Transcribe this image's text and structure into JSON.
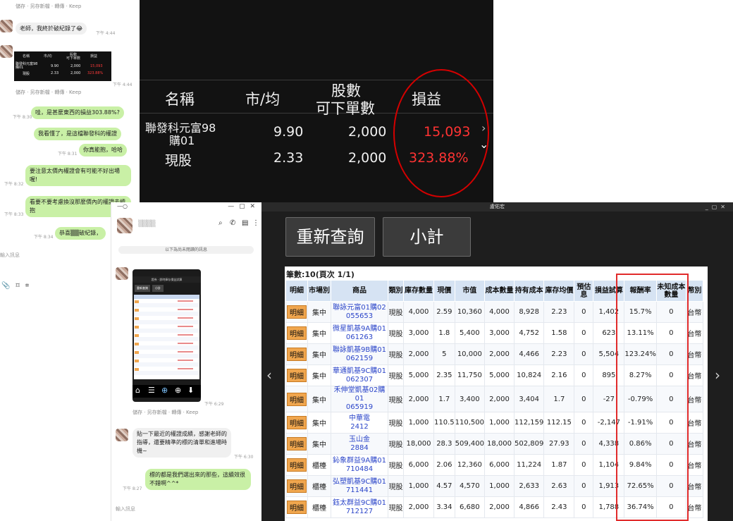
{
  "chat1": {
    "actions_1": "儲存 · 另存新檔 · 轉傳 · Keep",
    "msg_1": "老師，我終於破紀錄了😂",
    "time_1": "下午 4:44",
    "mini_table": {
      "headers": [
        "名稱",
        "市/均",
        "股數\n可下單數",
        "損益"
      ],
      "row1": [
        "聯發科元富98\n購01",
        "9.90",
        "2,000",
        "15,093"
      ],
      "row2": [
        "現股",
        "2.33",
        "2,000",
        "323.88%"
      ]
    },
    "time_2": "下午 4:44",
    "actions_2": "儲存 · 另存新檔 · 轉傳 · Keep",
    "out_1": "哇，是甚麼東西的損益303.88%?",
    "out_1_time": "下午 8:30",
    "out_2": "我看懂了，是這檔聯發科的權證",
    "out_3": "你真能抱，哈哈",
    "out_3_time": "下午 8:31",
    "out_4": "要注意太價內權證會有可能不好出場喔!",
    "out_4_time": "下午 8:32",
    "out_5": "看要不要考慮換沒那麼價內的權證去續抱",
    "out_5_time": "下午 8:33",
    "out_6": "恭喜▒▒破紀錄，",
    "out_6_time": "下午 8:34",
    "input_placeholder": "輸入訊息"
  },
  "zoom": {
    "headers": [
      "名稱",
      "市/均",
      "股數",
      "可下單數",
      "損益"
    ],
    "row1": {
      "name_line1": "聯發科元富98",
      "name_line2": "購01",
      "price": "9.90",
      "qty": "2,000",
      "pl": "15,093"
    },
    "row2": {
      "name": "現股",
      "price": "2.33",
      "qty": "2,000",
      "pl": "323.88%"
    }
  },
  "chat2": {
    "window_controls": "—  ▢  ✕",
    "contact_name": "▒▒▒▒",
    "notice": "以下為尚未閱讀的訊息",
    "phone_header": "證券 · 即時庫存損益試算",
    "phone_btn_1": "重新查詢",
    "phone_btn_2": "小計",
    "phone_time": "下午 6:29",
    "actions": "儲存 · 另存新檔 · 轉傳 · Keep",
    "msg_in": "貼一下最近的權證成績，感謝老師的指導，還要精準的標的清單和進場時機~",
    "msg_in_time": "下午 6:30",
    "msg_out": "標的都是我們選出來的那些，這續效很不錯啊^^*",
    "msg_out_time": "下午 8:27",
    "input_placeholder": "輸入訊息"
  },
  "broker": {
    "title": "盧佑宏",
    "btn_requery": "重新查詢",
    "btn_subtotal": "小計",
    "caption": "筆數:10(頁次 1/1)",
    "columns": [
      "明細",
      "市場別",
      "商品",
      "類別",
      "庫存數量",
      "現價",
      "市值",
      "成本數量",
      "持有成本",
      "庫存均價",
      "預估息",
      "損益試算",
      "報酬率",
      "未知成本數量",
      "幣別"
    ],
    "rows": [
      {
        "detail": "明細",
        "market": "集中",
        "prod1": "聯詠元富01購02",
        "prod2": "055653",
        "type": "現股",
        "qty": "4,000",
        "price": "2.59",
        "value": "10,360",
        "cost_qty": "4,000",
        "cost": "8,928",
        "avg": "2.23",
        "div": "0",
        "pl": "1,402",
        "ret": "15.7%",
        "unknown": "0",
        "cur": "台幣",
        "neg": false
      },
      {
        "detail": "明細",
        "market": "集中",
        "prod1": "微星凱基9A購01",
        "prod2": "061263",
        "type": "現股",
        "qty": "3,000",
        "price": "1.8",
        "value": "5,400",
        "cost_qty": "3,000",
        "cost": "4,752",
        "avg": "1.58",
        "div": "0",
        "pl": "623",
        "ret": "13.11%",
        "unknown": "0",
        "cur": "台幣",
        "neg": false
      },
      {
        "detail": "明細",
        "market": "集中",
        "prod1": "聯詠凱基9B購01",
        "prod2": "062159",
        "type": "現股",
        "qty": "2,000",
        "price": "5",
        "value": "10,000",
        "cost_qty": "2,000",
        "cost": "4,466",
        "avg": "2.23",
        "div": "0",
        "pl": "5,504",
        "ret": "123.24%",
        "unknown": "0",
        "cur": "台幣",
        "neg": false
      },
      {
        "detail": "明細",
        "market": "集中",
        "prod1": "華通凱基9C購01",
        "prod2": "062307",
        "type": "現股",
        "qty": "5,000",
        "price": "2.35",
        "value": "11,750",
        "cost_qty": "5,000",
        "cost": "10,824",
        "avg": "2.16",
        "div": "0",
        "pl": "895",
        "ret": "8.27%",
        "unknown": "0",
        "cur": "台幣",
        "neg": false
      },
      {
        "detail": "明細",
        "market": "集中",
        "prod1": "禾伸堂凱基02購01",
        "prod2": "065919",
        "type": "現股",
        "qty": "2,000",
        "price": "1.7",
        "value": "3,400",
        "cost_qty": "2,000",
        "cost": "3,404",
        "avg": "1.7",
        "div": "0",
        "pl": "-27",
        "ret": "-0.79%",
        "unknown": "0",
        "cur": "台幣",
        "neg": true
      },
      {
        "detail": "明細",
        "market": "集中",
        "prod1": "中華電",
        "prod2": "2412",
        "type": "現股",
        "qty": "1,000",
        "price": "110.5",
        "value": "110,500",
        "cost_qty": "1,000",
        "cost": "112,159",
        "avg": "112.15",
        "div": "0",
        "pl": "-2,147",
        "ret": "-1.91%",
        "unknown": "0",
        "cur": "台幣",
        "neg": true
      },
      {
        "detail": "明細",
        "market": "集中",
        "prod1": "玉山金",
        "prod2": "2884",
        "type": "現股",
        "qty": "18,000",
        "price": "28.3",
        "value": "509,400",
        "cost_qty": "18,000",
        "cost": "502,809",
        "avg": "27.93",
        "div": "0",
        "pl": "4,338",
        "ret": "0.86%",
        "unknown": "0",
        "cur": "台幣",
        "neg": false
      },
      {
        "detail": "明細",
        "market": "櫃檯",
        "prod1": "鈊象群益9A購01",
        "prod2": "710484",
        "type": "現股",
        "qty": "6,000",
        "price": "2.06",
        "value": "12,360",
        "cost_qty": "6,000",
        "cost": "11,224",
        "avg": "1.87",
        "div": "0",
        "pl": "1,104",
        "ret": "9.84%",
        "unknown": "0",
        "cur": "台幣",
        "neg": false
      },
      {
        "detail": "明細",
        "market": "櫃檯",
        "prod1": "弘塑凱基9C購01",
        "prod2": "711441",
        "type": "現股",
        "qty": "1,000",
        "price": "4.57",
        "value": "4,570",
        "cost_qty": "1,000",
        "cost": "2,633",
        "avg": "2.63",
        "div": "0",
        "pl": "1,913",
        "ret": "72.65%",
        "unknown": "0",
        "cur": "台幣",
        "neg": false
      },
      {
        "detail": "明細",
        "market": "櫃檯",
        "prod1": "鈺太群益9C購01",
        "prod2": "712127",
        "type": "現股",
        "qty": "2,000",
        "price": "3.34",
        "value": "6,680",
        "cost_qty": "2,000",
        "cost": "4,866",
        "avg": "2.43",
        "div": "0",
        "pl": "1,788",
        "ret": "36.74%",
        "unknown": "0",
        "cur": "台幣",
        "neg": false
      }
    ]
  }
}
